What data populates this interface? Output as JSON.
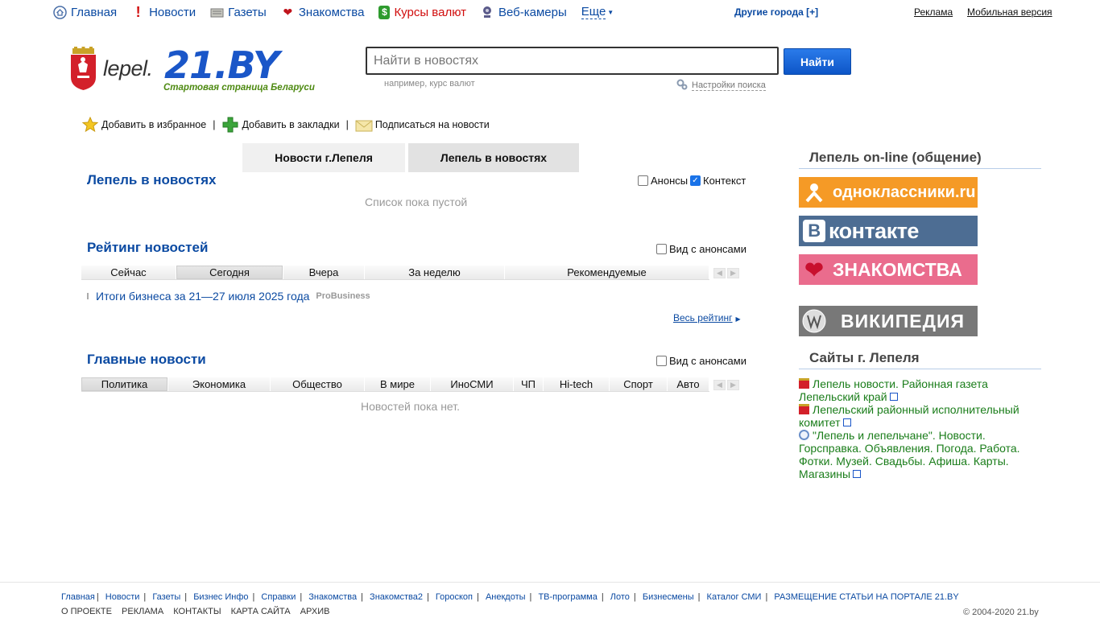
{
  "topnav": {
    "items": [
      {
        "label": "Главная",
        "icon": "home-icon"
      },
      {
        "label": "Новости",
        "icon": "exclamation-icon"
      },
      {
        "label": "Газеты",
        "icon": "newspaper-icon"
      },
      {
        "label": "Знакомства",
        "icon": "heart-icon"
      },
      {
        "label": "Курсы валют",
        "icon": "dollar-icon"
      },
      {
        "label": "Веб-камеры",
        "icon": "webcam-icon"
      }
    ],
    "more": "Еще",
    "other_cities": "Другие города [+]",
    "ads": "Реклама",
    "mobile": "Мобильная версия"
  },
  "header": {
    "city": "lepel.",
    "brand": "21.BY",
    "tagline": "Стартовая страница Беларуси",
    "search_placeholder": "Найти в новостях",
    "search_button": "Найти",
    "search_hint": "например, курс валют",
    "search_settings": "Настройки поиска"
  },
  "actions": {
    "favorites": "Добавить в избранное",
    "bookmarks": "Добавить в закладки",
    "subscribe": "Подписаться на новости"
  },
  "tabs": [
    "Новости г.Лепеля",
    "Лепель в новостях"
  ],
  "section_mentions": {
    "title": "Лепель в новостях",
    "announcements": "Анонсы",
    "context": "Контекст",
    "announcements_checked": false,
    "context_checked": true,
    "empty": "Список пока пустой"
  },
  "section_rating": {
    "title": "Рейтинг новостей",
    "view_announcements": "Вид с анонсами",
    "subtabs": [
      "Сейчас",
      "Сегодня",
      "Вчера",
      "За неделю",
      "Рекомендуемые"
    ],
    "selected": "Сегодня",
    "item_title": "Итоги бизнеса за 21—27 июля 2025 года",
    "item_source": "ProBusiness",
    "all_rating": "Весь рейтинг"
  },
  "section_main": {
    "title": "Главные новости",
    "view_announcements": "Вид с анонсами",
    "subtabs": [
      "Политика",
      "Экономика",
      "Общество",
      "В мире",
      "ИноСМИ",
      "ЧП",
      "Hi-tech",
      "Спорт",
      "Авто"
    ],
    "selected": "Политика",
    "empty": "Новостей пока нет."
  },
  "right": {
    "online_title": "Лепель on-line (общение)",
    "banners": {
      "ok": "одноклассники.ru",
      "vk": "контакте",
      "vk_letter": "В",
      "dating": "ЗНАКОМСТВА",
      "wiki": "ВИКИПЕДИЯ"
    },
    "sites_title": "Сайты г. Лепеля",
    "sites": [
      "Лепель новости. Районная газета Лепельский край",
      "Лепельский районный исполнительный комитет",
      "\"Лепель и лепельчане\". Новости. Горсправка. Объявления. Погода. Работа. Фотки. Музей. Свадьбы. Афиша. Карты. Магазины"
    ]
  },
  "footer": {
    "links": [
      "Главная",
      "Новости",
      "Газеты",
      "Бизнес Инфо",
      "Справки",
      "Знакомства",
      "Знакомства2",
      "Гороскоп",
      "Анекдоты",
      "ТВ-программа",
      "Лото",
      "Бизнесмены",
      "Каталог СМИ",
      "РАЗМЕЩЕНИЕ СТАТЬИ НА ПОРТАЛЕ 21.BY"
    ],
    "links2": [
      "О ПРОЕКТЕ",
      "РЕКЛАМА",
      "КОНТАКТЫ",
      "КАРТА САЙТА",
      "АРХИВ"
    ],
    "copyright": "© 2004-2020 21.by"
  },
  "colors": {
    "link": "#0b4aa2",
    "accent": "#1a56c8",
    "green": "#1a7d1a"
  }
}
